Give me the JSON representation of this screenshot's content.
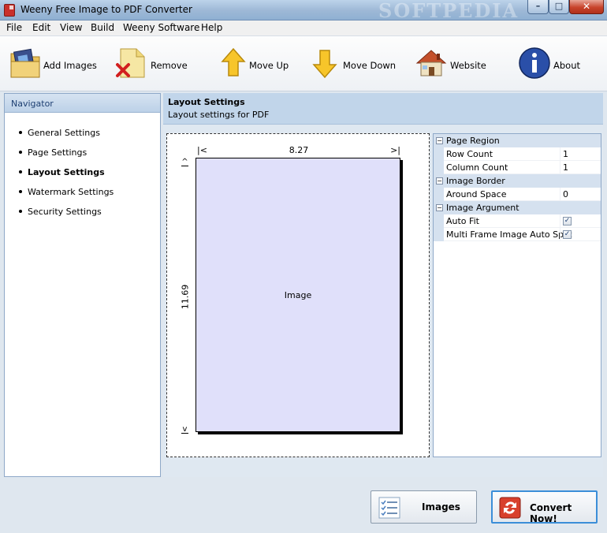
{
  "window": {
    "title": "Weeny Free Image to PDF Converter",
    "watermark": "SOFTPEDIA"
  },
  "menu": [
    "File",
    "Edit",
    "View",
    "Build",
    "Weeny Software",
    "Help"
  ],
  "toolbar": {
    "add_images": "Add Images",
    "remove": "Remove",
    "move_up": "Move Up",
    "move_down": "Move Down",
    "website": "Website",
    "about": "About"
  },
  "navigator": {
    "title": "Navigator",
    "items": [
      "General Settings",
      "Page Settings",
      "Layout Settings",
      "Watermark Settings",
      "Security Settings"
    ],
    "active": "Layout Settings"
  },
  "content": {
    "title": "Layout Settings",
    "subtitle": "Layout settings for PDF"
  },
  "preview": {
    "width_value": "8.27",
    "height_value": "11.69",
    "image_label": "Image",
    "h_left": "|<",
    "h_right": ">|",
    "v_top": "^",
    "v_bottom": "v"
  },
  "properties": {
    "page_region": {
      "label": "Page Region",
      "row_count_label": "Row Count",
      "row_count": "1",
      "column_count_label": "Column Count",
      "column_count": "1"
    },
    "image_border": {
      "label": "Image Border",
      "around_space_label": "Around Space",
      "around_space": "0"
    },
    "image_argument": {
      "label": "Image Argument",
      "auto_fit_label": "Auto Fit",
      "auto_fit": true,
      "multi_frame_label": "Multi Frame Image Auto Split",
      "multi_frame": true
    }
  },
  "buttons": {
    "images": "Images",
    "convert": "Convert Now!"
  }
}
